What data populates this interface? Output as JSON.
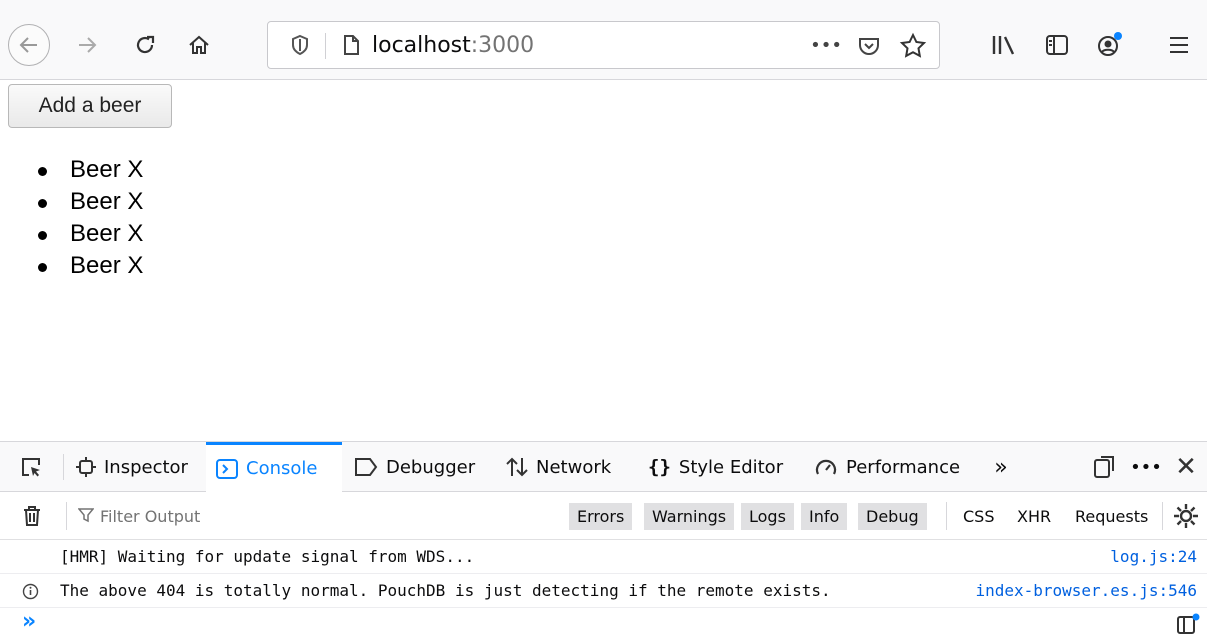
{
  "browser": {
    "url_host": "localhost",
    "url_port": ":3000",
    "url_more_label": "•••",
    "colors": {
      "toolbar_bg": "#f9f9fa",
      "accent": "#0a84ff",
      "link": "#0060df"
    }
  },
  "page": {
    "add_button_label": "Add a beer",
    "beers": [
      "Beer X",
      "Beer X",
      "Beer X",
      "Beer X"
    ]
  },
  "devtools": {
    "tabs": {
      "inspector": "Inspector",
      "console": "Console",
      "debugger": "Debugger",
      "network": "Network",
      "style_editor": "Style Editor",
      "performance": "Performance"
    },
    "more_tabs_label": "»",
    "menu_dots_label": "•••",
    "close_label": "✕",
    "filter_placeholder": "Filter Output",
    "levels": {
      "errors": "Errors",
      "warnings": "Warnings",
      "logs": "Logs",
      "info": "Info",
      "debug": "Debug"
    },
    "net_filters": {
      "css": "CSS",
      "xhr": "XHR",
      "requests": "Requests"
    },
    "messages": [
      {
        "text": "[HMR] Waiting for update signal from WDS...",
        "source": "log.js:24"
      },
      {
        "text": "The above 404 is totally normal. PouchDB is just detecting if the remote exists.",
        "source": "index-browser.es.js:546"
      }
    ],
    "prompt_label": "»"
  }
}
